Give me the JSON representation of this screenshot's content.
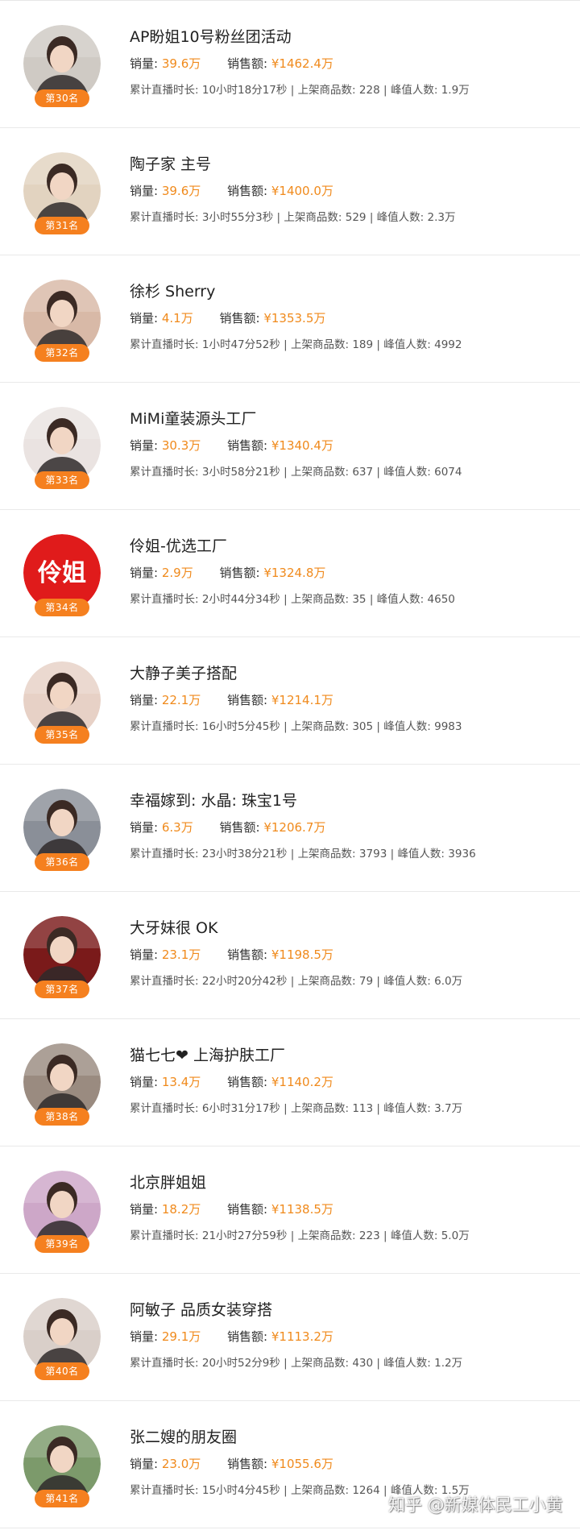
{
  "labels": {
    "sales": "销量:",
    "gmv": "销售额:",
    "duration": "累计直播时长:",
    "products": "上架商品数:",
    "peak": "峰值人数:",
    "sep": "|"
  },
  "rows": [
    {
      "rank": "第30名",
      "name": "AP盼姐10号粉丝团活动",
      "sales": "39.6万",
      "gmv": "¥1462.4万",
      "duration": "10小时18分17秒",
      "products": "228",
      "peak": "1.9万",
      "avatar_icon": "person-photo-icon",
      "avatar_bg": "#cfcac4"
    },
    {
      "rank": "第31名",
      "name": "陶子家 主号",
      "sales": "39.6万",
      "gmv": "¥1400.0万",
      "duration": "3小时55分3秒",
      "products": "529",
      "peak": "2.3万",
      "avatar_icon": "person-photo-icon",
      "avatar_bg": "#e2d3c0"
    },
    {
      "rank": "第32名",
      "name": "徐杉 Sherry",
      "sales": "4.1万",
      "gmv": "¥1353.5万",
      "duration": "1小时47分52秒",
      "products": "189",
      "peak": "4992",
      "avatar_icon": "person-photo-icon",
      "avatar_bg": "#d8b9a7"
    },
    {
      "rank": "第33名",
      "name": "MiMi童装源头工厂",
      "sales": "30.3万",
      "gmv": "¥1340.4万",
      "duration": "3小时58分21秒",
      "products": "637",
      "peak": "6074",
      "avatar_icon": "person-photo-icon",
      "avatar_bg": "#eae3e1"
    },
    {
      "rank": "第34名",
      "name": "伶姐-优选工厂",
      "sales": "2.9万",
      "gmv": "¥1324.8万",
      "duration": "2小时44分34秒",
      "products": "35",
      "peak": "4650",
      "avatar_icon": "logo-text-icon",
      "avatar_text": "伶姐",
      "avatar_bg": "#e01b1b"
    },
    {
      "rank": "第35名",
      "name": "大静子美子搭配",
      "sales": "22.1万",
      "gmv": "¥1214.1万",
      "duration": "16小时5分45秒",
      "products": "305",
      "peak": "9983",
      "avatar_icon": "person-photo-icon",
      "avatar_bg": "#e7d1c6"
    },
    {
      "rank": "第36名",
      "name": "幸福嫁到: 水晶: 珠宝1号",
      "sales": "6.3万",
      "gmv": "¥1206.7万",
      "duration": "23小时38分21秒",
      "products": "3793",
      "peak": "3936",
      "avatar_icon": "person-photo-icon",
      "avatar_bg": "#8a8f98"
    },
    {
      "rank": "第37名",
      "name": "大牙妹很 OK",
      "sales": "23.1万",
      "gmv": "¥1198.5万",
      "duration": "22小时20分42秒",
      "products": "79",
      "peak": "6.0万",
      "avatar_icon": "person-photo-icon",
      "avatar_bg": "#7a1a1a"
    },
    {
      "rank": "第38名",
      "name": "猫七七❤  上海护肤工厂",
      "sales": "13.4万",
      "gmv": "¥1140.2万",
      "duration": "6小时31分17秒",
      "products": "113",
      "peak": "3.7万",
      "avatar_icon": "person-photo-icon",
      "avatar_bg": "#9a8b80"
    },
    {
      "rank": "第39名",
      "name": "北京胖姐姐",
      "sales": "18.2万",
      "gmv": "¥1138.5万",
      "duration": "21小时27分59秒",
      "products": "223",
      "peak": "5.0万",
      "avatar_icon": "person-photo-icon",
      "avatar_bg": "#cda7c8"
    },
    {
      "rank": "第40名",
      "name": "阿敏子  品质女装穿搭",
      "sales": "29.1万",
      "gmv": "¥1113.2万",
      "duration": "20小时52分9秒",
      "products": "430",
      "peak": "1.2万",
      "avatar_icon": "person-photo-icon",
      "avatar_bg": "#d9cfc9"
    },
    {
      "rank": "第41名",
      "name": "张二嫂的朋友圈",
      "sales": "23.0万",
      "gmv": "¥1055.6万",
      "duration": "15小时4分45秒",
      "products": "1264",
      "peak": "1.5万",
      "avatar_icon": "person-photo-icon",
      "avatar_bg": "#7c9a6b"
    }
  ],
  "watermark": "知乎 @新媒体民工小黄"
}
